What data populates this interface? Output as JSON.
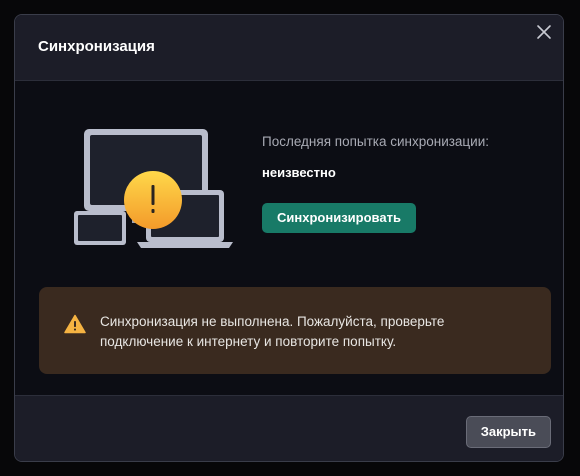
{
  "dialog": {
    "title": "Синхронизация",
    "close_icon": "close-icon"
  },
  "sync": {
    "last_attempt_label": "Последняя попытка синхронизации:",
    "last_attempt_value": "неизвестно",
    "sync_button_label": "Синхронизировать",
    "illustration_icon": "devices-warning-icon"
  },
  "warning": {
    "icon": "warning-triangle-icon",
    "message": "Синхронизация не выполнена. Пожалуйста, проверьте подключение к интернету и повторите попытку."
  },
  "footer": {
    "close_button_label": "Закрыть"
  },
  "colors": {
    "accent": "#187a67",
    "warning_bg": "#3a2a1f",
    "warning_icon": "#f5b342",
    "badge": "#f5b342"
  }
}
